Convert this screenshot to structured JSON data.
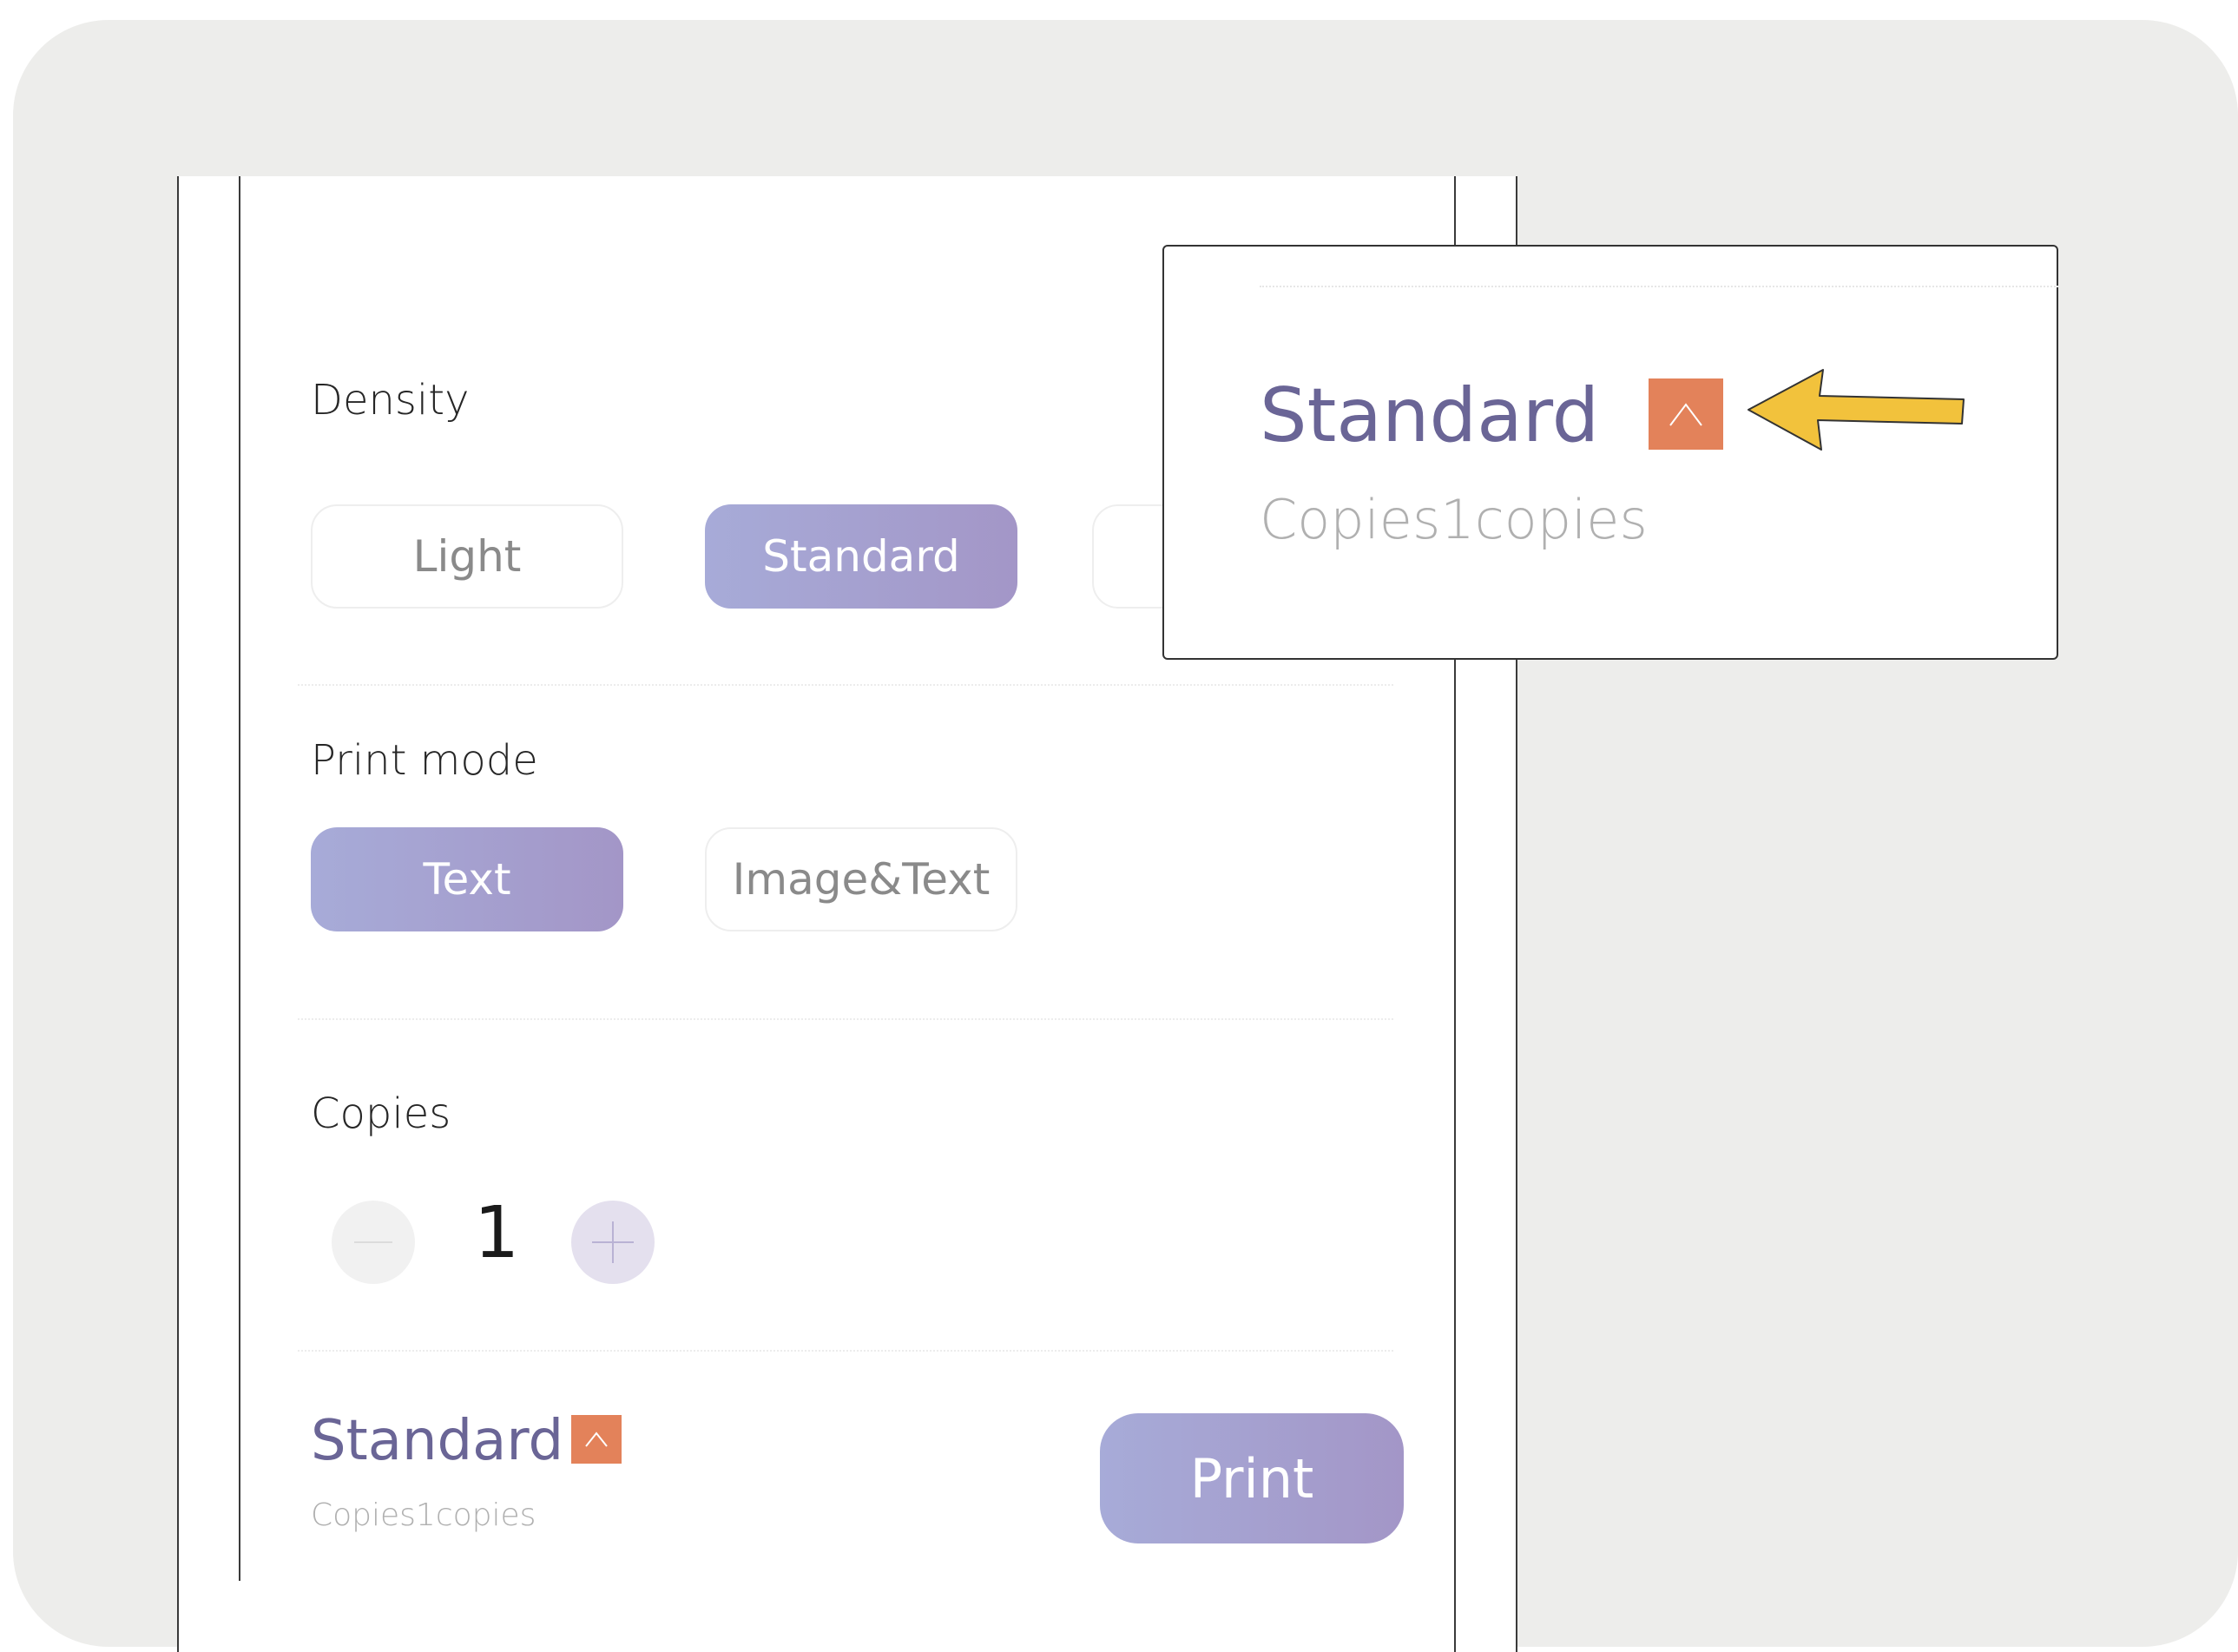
{
  "density": {
    "label": "Density",
    "options": [
      "Light",
      "Standard"
    ],
    "selected": "Standard"
  },
  "print_mode": {
    "label": "Print mode",
    "options": [
      "Text",
      "Image&Text"
    ],
    "selected": "Text"
  },
  "copies": {
    "label": "Copies",
    "value": "1",
    "minus_icon": "minus-icon",
    "plus_icon": "plus-icon"
  },
  "summary": {
    "title": "Standard",
    "subtitle": "Copies1copies",
    "caret_icon": "caret-up-icon"
  },
  "print_button": {
    "label": "Print"
  },
  "callout": {
    "title": "Standard",
    "subtitle": "Copies1copies",
    "caret_icon": "caret-up-icon",
    "pointer": "arrow-left-icon"
  },
  "colors": {
    "accent_start": "#a7abd8",
    "accent_end": "#a396c7",
    "title_text": "#6a6596",
    "caret_box": "#e3825a",
    "arrow": "#f2c23c"
  }
}
